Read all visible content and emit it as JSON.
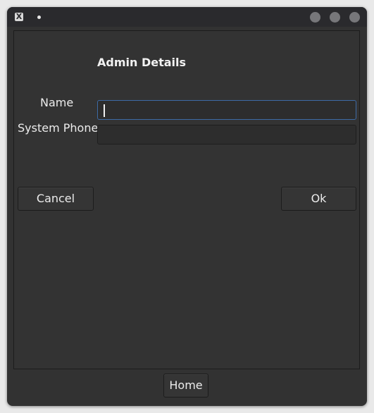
{
  "window": {
    "app_icon_glyph": "X",
    "title_indicator": "•"
  },
  "form": {
    "heading": "Admin Details",
    "name_label": "Name",
    "name_value": "",
    "phone_label": "System Phone",
    "phone_value": ""
  },
  "buttons": {
    "cancel_label": "Cancel",
    "ok_label": "Ok",
    "home_label": "Home"
  }
}
